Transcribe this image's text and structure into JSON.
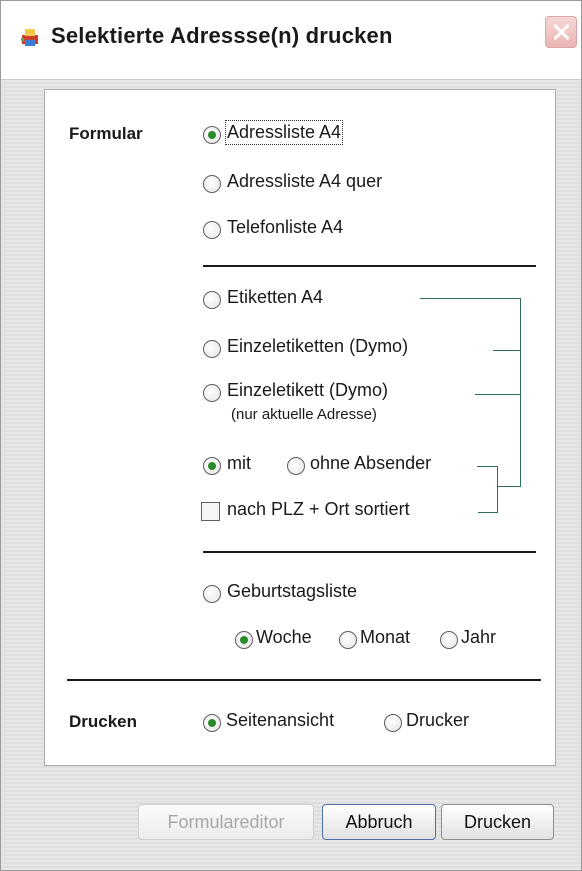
{
  "window": {
    "title": "Selektierte Adressse(n) drucken"
  },
  "formular": {
    "label": "Formular",
    "options": [
      "Adressliste A4",
      "Adressliste A4 quer",
      "Telefonliste A4"
    ],
    "label_options": [
      "Etiketten A4",
      "Einzeletiketten (Dymo)",
      "Einzeletikett (Dymo)"
    ],
    "single_label_note": "(nur aktuelle Adresse)",
    "sender": {
      "with": "mit",
      "without": "ohne Absender",
      "selected": "mit"
    },
    "sort_checkbox": {
      "label": "nach PLZ + Ort sortiert",
      "checked": false
    },
    "birthday": {
      "label": "Geburtstagsliste",
      "periods": [
        "Woche",
        "Monat",
        "Jahr"
      ],
      "selected_period": "Woche"
    },
    "selected": "Adressliste A4"
  },
  "drucken": {
    "label": "Drucken",
    "options": [
      "Seitenansicht",
      "Drucker"
    ],
    "selected": "Seitenansicht"
  },
  "buttons": {
    "formulareditor": "Formulareditor",
    "abbruch": "Abbruch",
    "drucken": "Drucken"
  }
}
